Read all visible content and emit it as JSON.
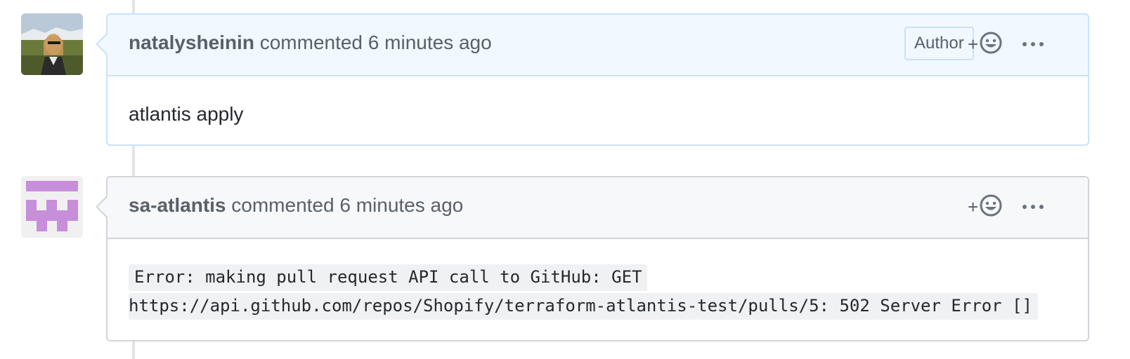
{
  "comments": [
    {
      "author": "natalysheinin",
      "action": "commented",
      "time": "6 minutes ago",
      "badge": "Author",
      "body": "atlantis apply"
    },
    {
      "author": "sa-atlantis",
      "action": "commented",
      "time": "6 minutes ago",
      "body_lines": [
        "Error: making pull request API call to GitHub: GET",
        "https://api.github.com/repos/Shopify/terraform-atlantis-test/pulls/5: 502 Server Error []"
      ]
    }
  ],
  "icons": {
    "reaction": "smiley-icon",
    "menu": "kebab-horizontal-icon"
  },
  "colors": {
    "author_header_bg": "#f1f8ff",
    "author_border": "#c8e1ff",
    "bot_header_bg": "#f6f8fa",
    "bot_border": "#d1d5da",
    "identicon": "#c78ed9"
  }
}
